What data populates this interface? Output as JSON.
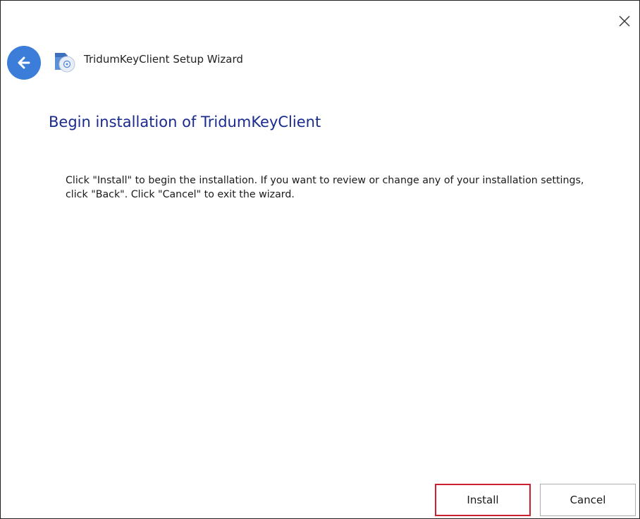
{
  "window": {
    "title": "TridumKeyClient Setup Wizard",
    "icons": {
      "close": "close-icon",
      "back": "arrow-left-icon",
      "app": "installer-disc-icon"
    }
  },
  "page": {
    "heading": "Begin installation of TridumKeyClient",
    "description": "Click \"Install\" to begin the installation.  If you want to review or change any of your installation settings, click \"Back\".  Click \"Cancel\" to exit the wizard."
  },
  "buttons": {
    "install_label": "Install",
    "cancel_label": "Cancel"
  },
  "colors": {
    "heading": "#1a2b8f",
    "back_button": "#3b7dd8",
    "install_highlight": "#cc1f2f"
  }
}
